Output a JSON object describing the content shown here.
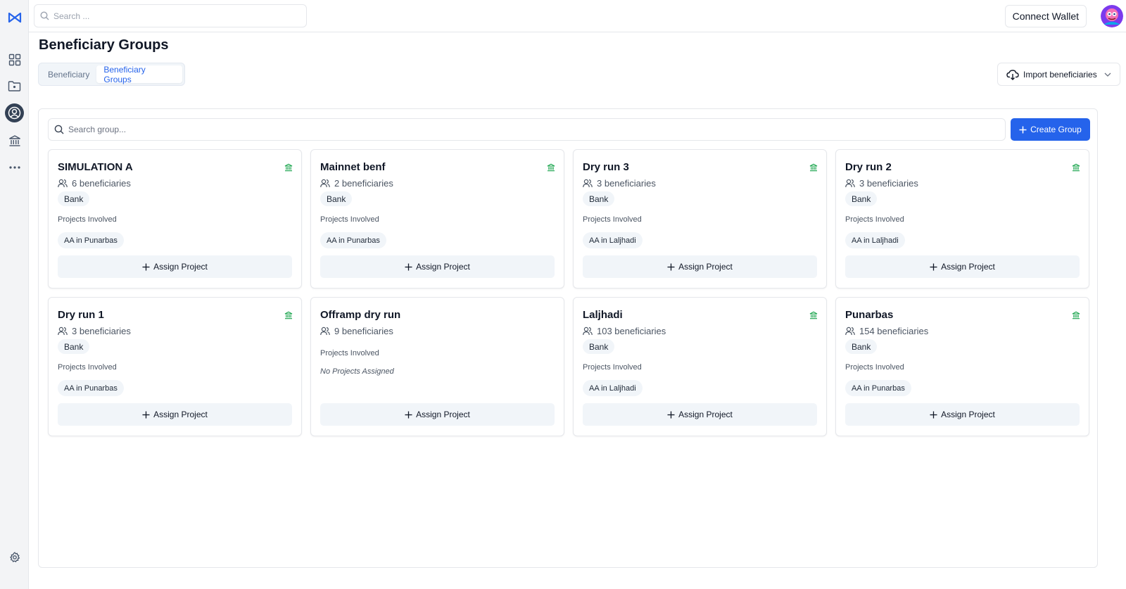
{
  "colors": {
    "accent": "#2563eb",
    "bank_icon": "#16a34a",
    "sidebar_bg": "#f3f4f6"
  },
  "sidebar": {
    "items": [
      {
        "icon": "logo-icon"
      },
      {
        "icon": "dashboard-grid-icon"
      },
      {
        "icon": "folder-icon"
      },
      {
        "icon": "user-circle-icon",
        "active": true
      },
      {
        "icon": "bank-icon"
      },
      {
        "icon": "more-dots-icon"
      },
      {
        "icon": "gear-icon"
      }
    ]
  },
  "topbar": {
    "search_placeholder": "Search ...",
    "connect_label": "Connect Wallet",
    "avatar_icon": "avatar-icon"
  },
  "page": {
    "title": "Beneficiary Groups",
    "tabs": [
      {
        "label": "Beneficiary",
        "active": false
      },
      {
        "label": "Beneficiary Groups",
        "active": true
      }
    ],
    "import_label": "Import beneficiaries"
  },
  "panel": {
    "search_placeholder": "Search group...",
    "create_label": "Create Group",
    "projects_label": "Projects Involved",
    "assign_label": "Assign Project",
    "groups": [
      {
        "title": "SIMULATION A",
        "beneficiaries": "6 beneficiaries",
        "bank": "Bank",
        "project": "AA in Punarbas"
      },
      {
        "title": "Mainnet benf",
        "beneficiaries": "2 beneficiaries",
        "bank": "Bank",
        "project": "AA in Punarbas"
      },
      {
        "title": "Dry run 3",
        "beneficiaries": "3 beneficiaries",
        "bank": "Bank",
        "project": "AA in Laljhadi"
      },
      {
        "title": "Dry run 2",
        "beneficiaries": "3 beneficiaries",
        "bank": "Bank",
        "project": "AA in Laljhadi"
      },
      {
        "title": "Dry run 1",
        "beneficiaries": "3 beneficiaries",
        "bank": "Bank",
        "project": "AA in Punarbas"
      },
      {
        "title": "Offramp dry run",
        "beneficiaries": "9 beneficiaries",
        "bank": "",
        "project": "",
        "no_projects": "No Projects Assigned"
      },
      {
        "title": "Laljhadi",
        "beneficiaries": "103 beneficiaries",
        "bank": "Bank",
        "project": "AA in Laljhadi"
      },
      {
        "title": "Punarbas",
        "beneficiaries": "154 beneficiaries",
        "bank": "Bank",
        "project": "AA in Punarbas"
      }
    ]
  }
}
